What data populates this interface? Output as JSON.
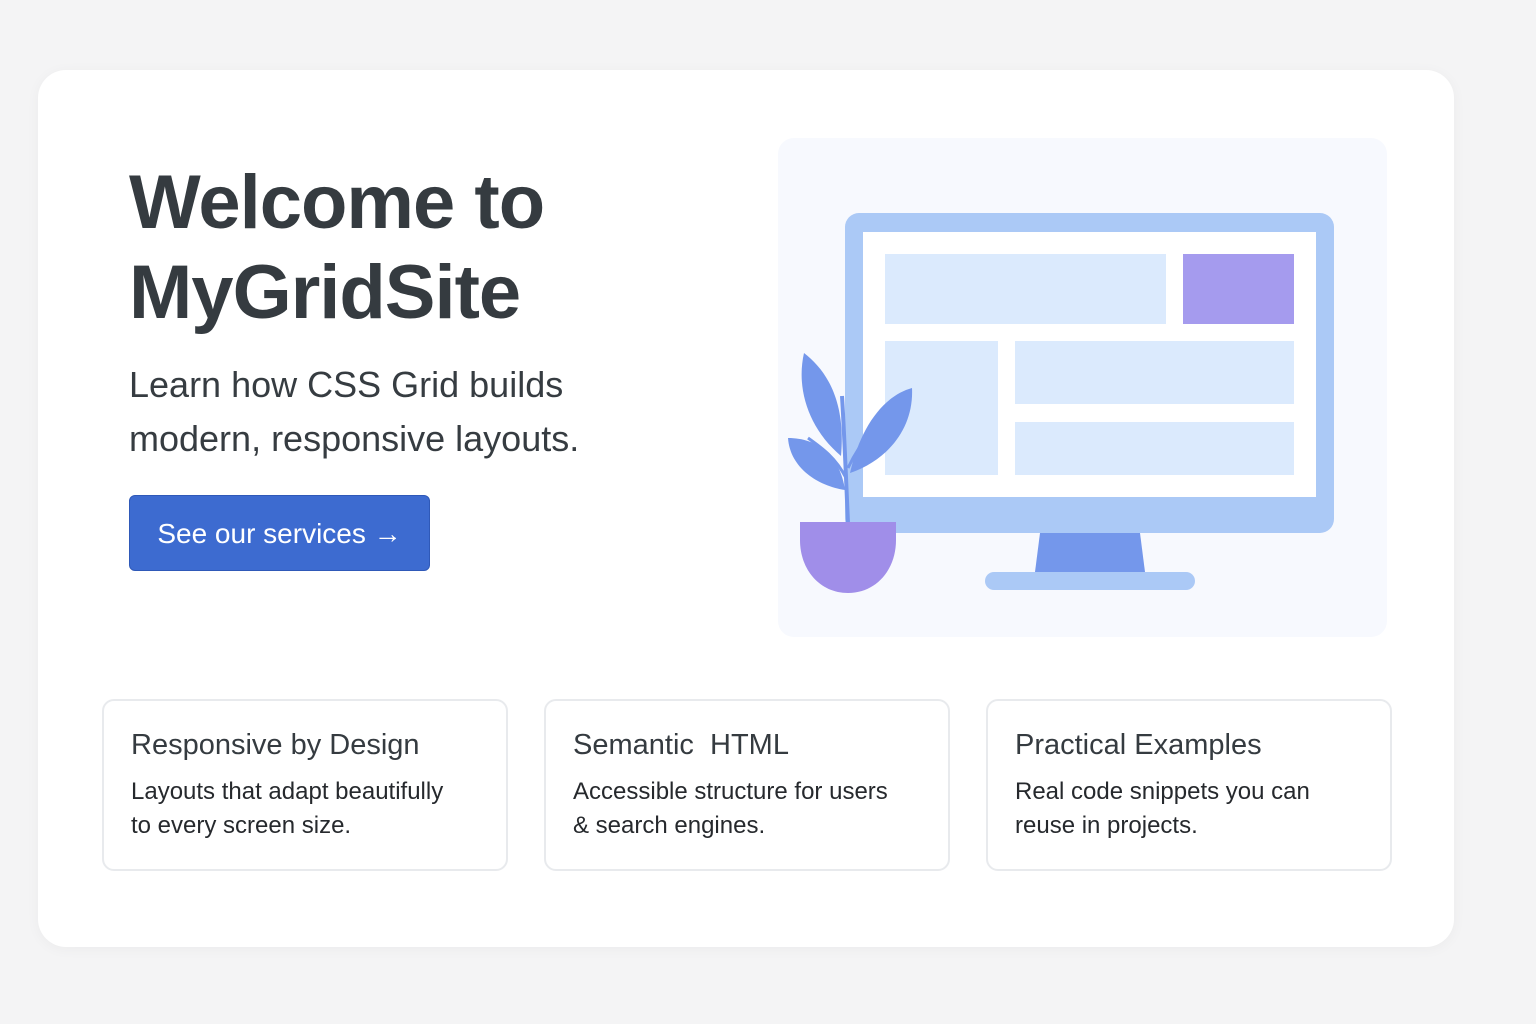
{
  "hero": {
    "title_line1": "Welcome to",
    "title_line2": "MyGridSite",
    "subtitle_line1": "Learn how CSS Grid builds",
    "subtitle_line2": "modern, responsive layouts.",
    "cta_label": "See our services →"
  },
  "illustration": {
    "icons": [
      "monitor-icon",
      "plant-icon"
    ],
    "colors": {
      "panel_bg": "#f7f9fe",
      "monitor_frame": "#abc9f6",
      "monitor_screen": "#ffffff",
      "block_light": "#dbeafd",
      "block_accent": "#a59bee",
      "stand": "#7497eb",
      "leaf": "#7497eb",
      "pot": "#a08ee9"
    }
  },
  "features": [
    {
      "title": "Responsive by Design",
      "text_line1": "Layouts that adapt beautifully",
      "text_line2": "to every screen size."
    },
    {
      "title": "Semantic  HTML",
      "text_line1": "Accessible structure for users",
      "text_line2": "& search engines."
    },
    {
      "title": "Practical Examples",
      "text_line1": "Real code snippets you can",
      "text_line2": "reuse in projects."
    }
  ],
  "colors": {
    "page_bg": "#f4f4f5",
    "card_bg": "#ffffff",
    "heading": "#353b40",
    "button": "#3d6bd0",
    "button_text": "#ffffff",
    "card_border": "#e8eaed"
  }
}
